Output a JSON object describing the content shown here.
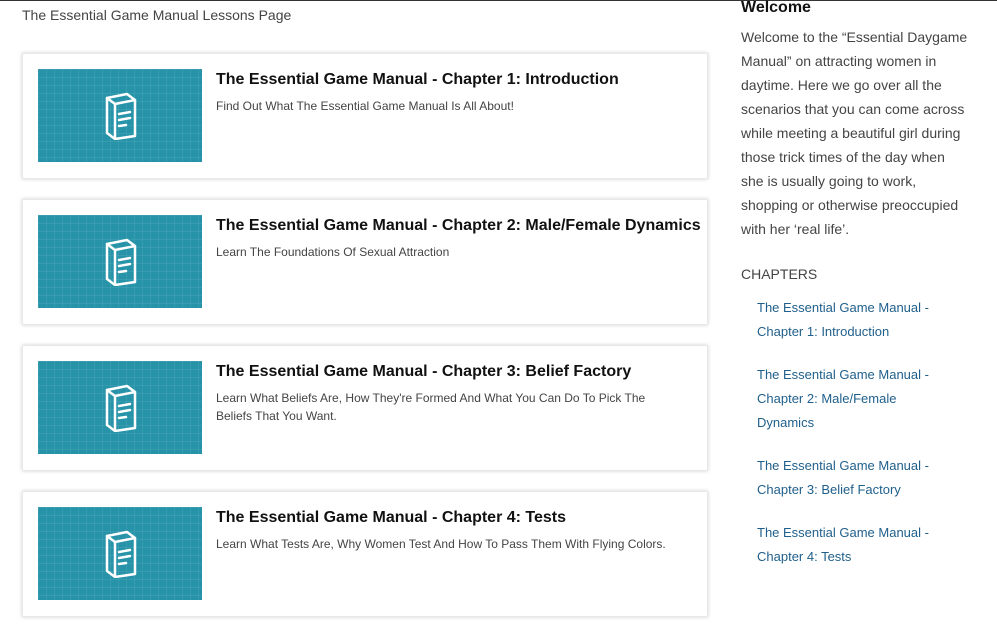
{
  "page": {
    "heading": "The Essential Game Manual Lessons Page"
  },
  "lessons": [
    {
      "title": "The Essential Game Manual - Chapter 1: Introduction",
      "description": "Find Out What The Essential Game Manual Is All About!"
    },
    {
      "title": "The Essential Game Manual - Chapter 2: Male/Female Dynamics",
      "description": "Learn The Foundations Of Sexual Attraction"
    },
    {
      "title": "The Essential Game Manual - Chapter 3: Belief Factory",
      "description": "Learn What Beliefs Are, How They're Formed And What You Can Do To Pick The Beliefs That You Want."
    },
    {
      "title": "The Essential Game Manual - Chapter 4: Tests",
      "description": "Learn What Tests Are, Why Women Test And How To Pass Them With Flying Colors."
    }
  ],
  "sidebar": {
    "welcome_title": "Welcome",
    "welcome_text": "Welcome to the “Essential Daygame Manual” on attracting women in daytime. Here we go over all the scenarios that you can come across while meeting a beautiful girl during those trick times of the day when she is usually going to work, shopping or otherwise preoccupied with her ‘real life’.",
    "chapters_heading": "CHAPTERS",
    "chapter_links": [
      "The Essential Game Manual - Chapter 1: Introduction",
      "The Essential Game Manual - Chapter 2: Male/Female Dynamics",
      "The Essential Game Manual - Chapter 3: Belief Factory",
      "The Essential Game Manual - Chapter 4: Tests"
    ]
  },
  "colors": {
    "thumbnail": "#2793a9",
    "link": "#1f5f8b"
  },
  "icons": {
    "thumbnail": "book-icon"
  }
}
